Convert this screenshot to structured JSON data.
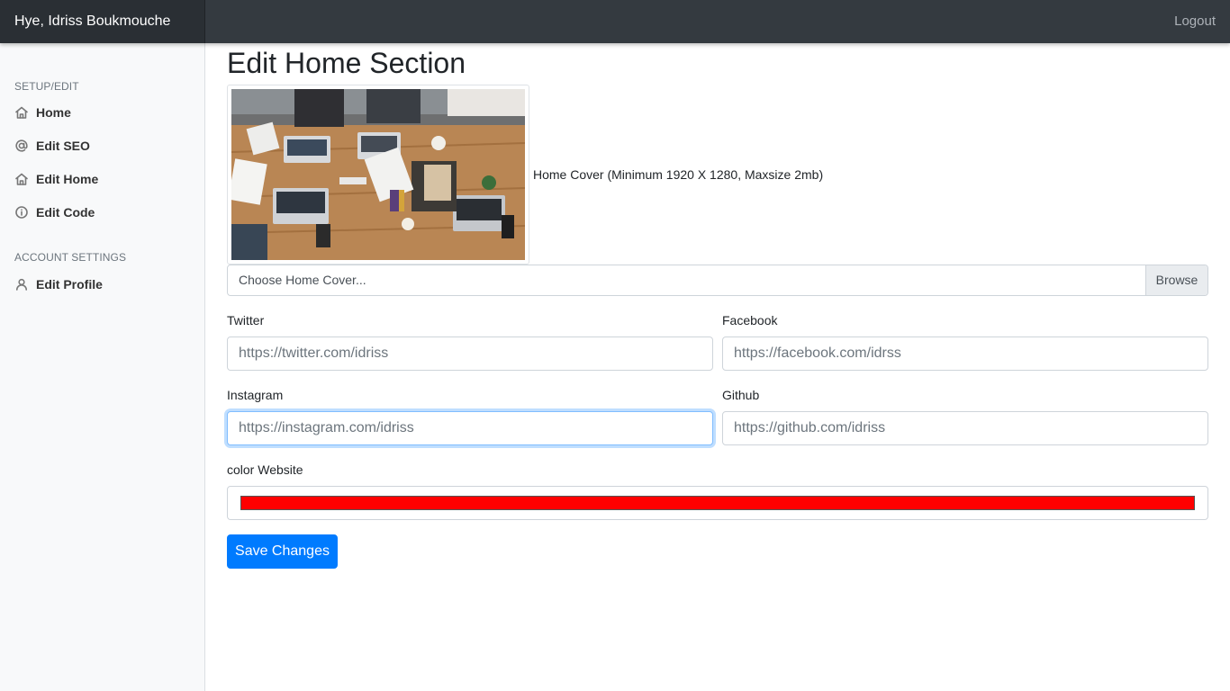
{
  "navbar": {
    "brand": "Hye, Idriss Boukmouche",
    "logout_label": "Logout"
  },
  "sidebar": {
    "setup_heading": "SETUP/EDIT",
    "setup_items": [
      {
        "label": "Home",
        "icon": "home-icon"
      },
      {
        "label": "Edit SEO",
        "icon": "at-icon"
      },
      {
        "label": "Edit Home",
        "icon": "home-icon"
      },
      {
        "label": "Edit Code",
        "icon": "info-icon"
      }
    ],
    "account_heading": "ACCOUNT SETTINGS",
    "account_items": [
      {
        "label": "Edit Profile",
        "icon": "user-icon"
      }
    ]
  },
  "main": {
    "title": "Edit Home Section",
    "cover_note": "Home Cover (Minimum 1920 X 1280, Maxsize 2mb)",
    "file_input": {
      "label": "Choose Home Cover...",
      "browse_label": "Browse"
    },
    "fields": {
      "twitter": {
        "label": "Twitter",
        "placeholder": "https://twitter.com/idriss"
      },
      "facebook": {
        "label": "Facebook",
        "placeholder": "https://facebook.com/idrss"
      },
      "instagram": {
        "label": "Instagram",
        "placeholder": "https://instagram.com/idriss"
      },
      "github": {
        "label": "Github",
        "placeholder": "https://github.com/idriss"
      }
    },
    "color": {
      "label": "color Website",
      "value": "#ff0000"
    },
    "save_label": "Save Changes"
  },
  "colors": {
    "navbar": "#343a40",
    "primary": "#007bff",
    "sidebar_bg": "#f8f9fa"
  }
}
